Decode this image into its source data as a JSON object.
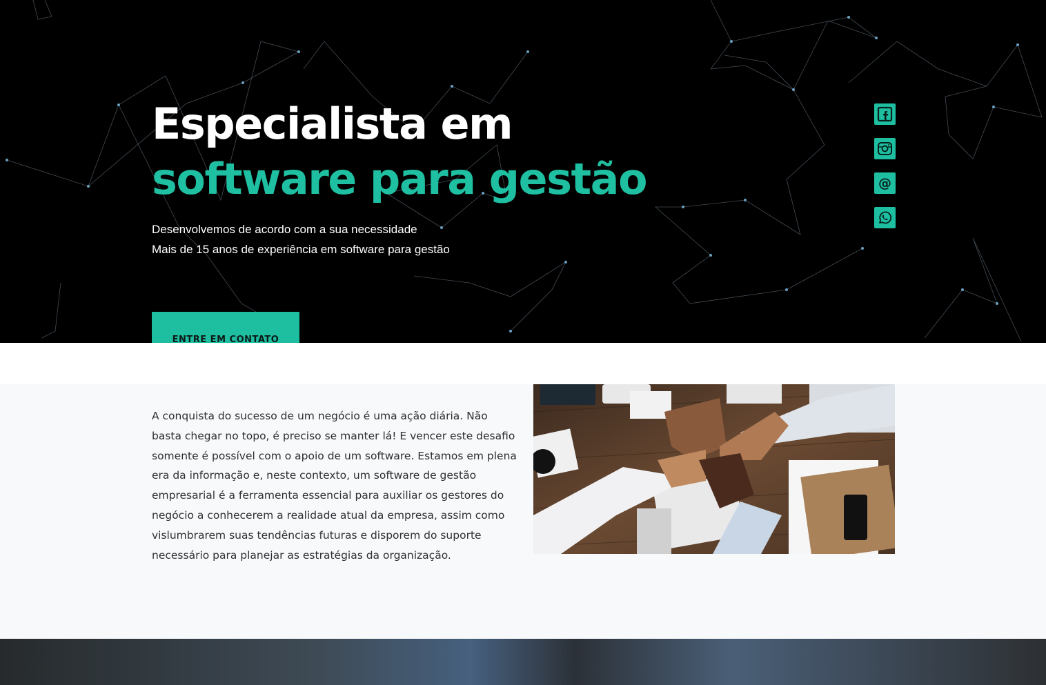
{
  "hero": {
    "title_part1": "Especialista em ",
    "title_highlight": "software para gestão",
    "subtitle_line1": "Desenvolvemos de acordo com a sua necessidade",
    "subtitle_line2": "Mais de 15 anos de experiência em software para gestão",
    "cta_label": "ENTRE EM CONTATO"
  },
  "social": [
    {
      "icon": "facebook-icon"
    },
    {
      "icon": "instagram-icon"
    },
    {
      "icon": "email-at-icon"
    },
    {
      "icon": "whatsapp-icon"
    }
  ],
  "about": {
    "paragraph": "A conquista do sucesso de um negócio é uma ação diária. Não basta chegar no topo, é preciso se manter lá! E vencer este desafio somente é possível com o apoio de um software. Estamos em plena era da informação e, neste contexto, um software de gestão empresarial é a ferramenta essencial para auxiliar os gestores do negócio a conhecerem a realidade atual da empresa, assim como vislumbrarem suas tendências futuras e disporem do suporte necessário para planejar as estratégias da organização."
  },
  "colors": {
    "accent": "#1ebfa1",
    "hero_bg": "#000000",
    "section_bg": "#f8f9fa"
  }
}
